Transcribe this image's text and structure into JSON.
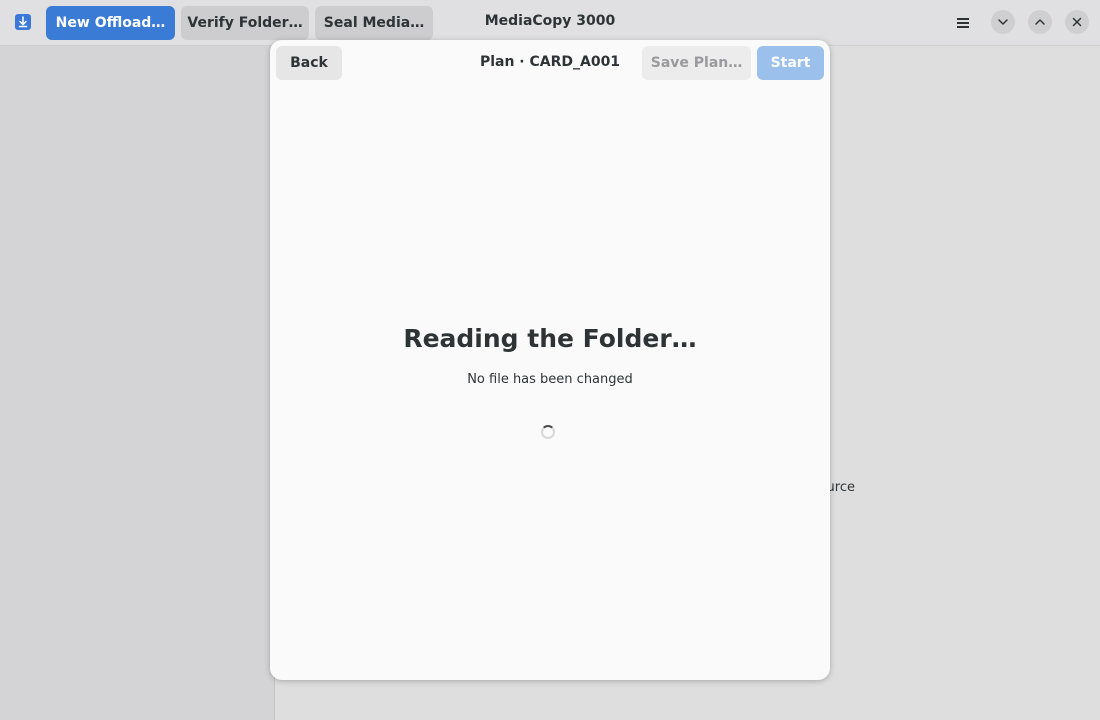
{
  "header": {
    "app_icon": "download-icon",
    "new_offload_label": "New Offload…",
    "verify_folder_label": "Verify Folder…",
    "seal_media_label": "Seal Media…",
    "title": "MediaCopy 3000",
    "menu_icon": "hamburger-menu-icon",
    "window_controls": [
      "chevron-down-icon",
      "chevron-up-icon",
      "close-icon"
    ]
  },
  "background": {
    "partial_text": "urce"
  },
  "dialog": {
    "back_label": "Back",
    "title": "Plan · CARD_A001",
    "save_plan_label": "Save Plan…",
    "start_label": "Start",
    "status_heading": "Reading the Folder…",
    "status_subtext": "No file has been changed"
  },
  "colors": {
    "accent": "#3a7bd5",
    "accent_disabled": "#9cc0ec",
    "header_bg": "#e0e0e2",
    "dialog_bg": "#fafafa"
  }
}
